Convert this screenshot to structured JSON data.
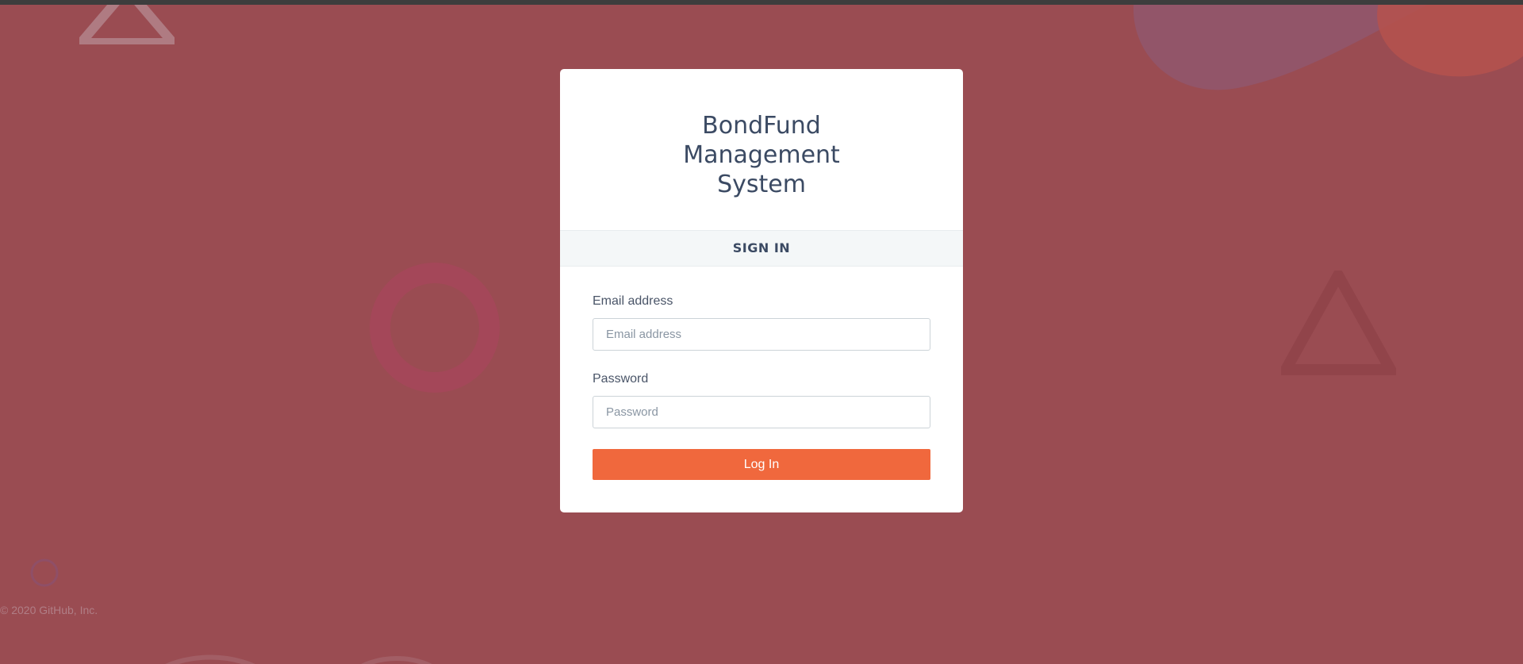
{
  "app": {
    "title_lines": [
      "BondFund",
      "Management",
      "System"
    ]
  },
  "signin": {
    "heading": "SIGN IN",
    "email_label": "Email address",
    "email_placeholder": "Email address",
    "email_value": "",
    "password_label": "Password",
    "password_placeholder": "Password",
    "password_value": "",
    "login_label": "Log In"
  },
  "footer": {
    "copyright": "© 2020 GitHub, Inc."
  },
  "colors": {
    "background": "#9a4c52",
    "card": "#ffffff",
    "accent": "#f0683d",
    "title_text": "#3b4a63"
  },
  "icons": [
    "triangle-shape",
    "ring-shape",
    "blob-shape",
    "circle-shape"
  ]
}
